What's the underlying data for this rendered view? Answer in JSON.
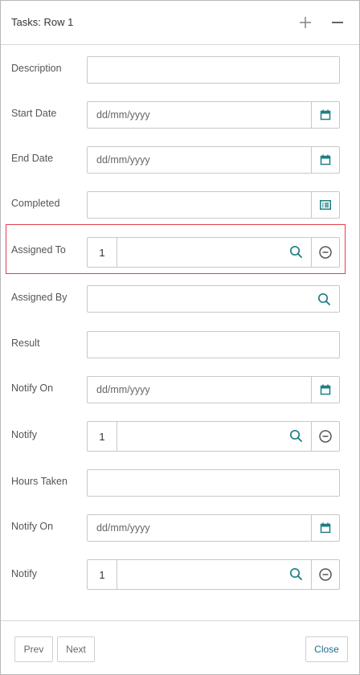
{
  "header": {
    "title": "Tasks: Row 1",
    "add_icon": "plus-icon",
    "minimize_icon": "minus-icon"
  },
  "fields": {
    "description": {
      "label": "Description",
      "value": ""
    },
    "start_date": {
      "label": "Start Date",
      "placeholder": "dd/mm/yyyy",
      "icon": "calendar-icon"
    },
    "end_date": {
      "label": "End Date",
      "placeholder": "dd/mm/yyyy",
      "icon": "calendar-icon"
    },
    "completed": {
      "label": "Completed",
      "value": "",
      "icon": "list-icon"
    },
    "assigned_to": {
      "label": "Assigned To",
      "value": "1"
    },
    "assigned_by": {
      "label": "Assigned By",
      "value": ""
    },
    "result": {
      "label": "Result",
      "value": ""
    },
    "notify_on_1": {
      "label": "Notify On",
      "placeholder": "dd/mm/yyyy",
      "icon": "calendar-icon"
    },
    "notify_1": {
      "label": "Notify",
      "value": "1"
    },
    "hours_taken": {
      "label": "Hours Taken",
      "value": ""
    },
    "notify_on_2": {
      "label": "Notify On",
      "placeholder": "dd/mm/yyyy",
      "icon": "calendar-icon"
    },
    "notify_2": {
      "label": "Notify",
      "value": "1"
    }
  },
  "footer": {
    "prev_label": "Prev",
    "next_label": "Next",
    "close_label": "Close"
  },
  "colors": {
    "accent": "#1f7f82",
    "highlight_border": "#e0414b",
    "label_text": "#555555",
    "border": "#c8c8c8"
  }
}
